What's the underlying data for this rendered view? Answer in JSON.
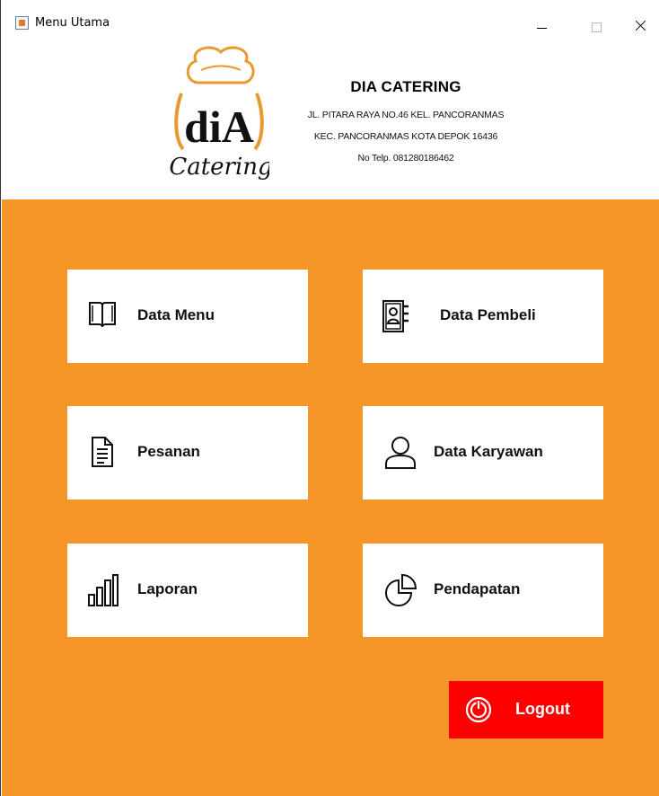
{
  "window": {
    "title": "Menu Utama"
  },
  "header": {
    "logo_text": "diA",
    "logo_script": "Catering",
    "company_name": "DIA CATERING",
    "address_line1": "JL. PITARA RAYA NO.46 KEL. PANCORANMAS",
    "address_line2": "KEC. PANCORANMAS KOTA DEPOK 16436",
    "phone": "No Telp. 081280186462"
  },
  "menu": {
    "data_menu": "Data Menu",
    "data_pembeli": "Data Pembeli",
    "pesanan": "Pesanan",
    "data_karyawan": "Data Karyawan",
    "laporan": "Laporan",
    "pendapatan": "Pendapatan",
    "logout": "Logout"
  },
  "colors": {
    "panel": "#f79628",
    "logout": "#ff0000",
    "logo_orange": "#f0a23c"
  }
}
